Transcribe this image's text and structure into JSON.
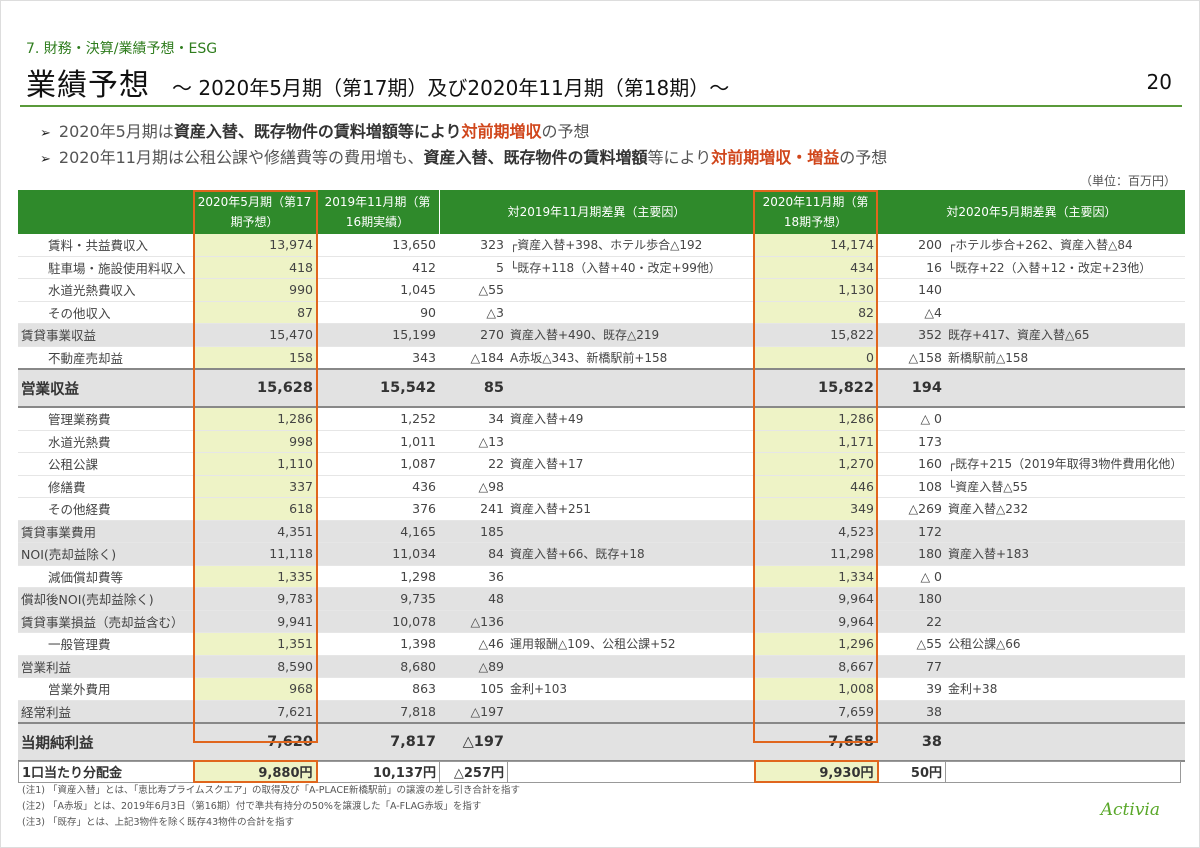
{
  "section": "7. 財務・決算/業績予想・ESG",
  "title": "業績予想",
  "subtitle": "～ 2020年5月期（第17期）及び2020年11月期（第18期）～",
  "page_number": "20",
  "bullets": [
    {
      "arrow": "➢",
      "p1": "2020年5月期は",
      "b1": "資産入替、既存物件の賃料増額等により",
      "r1": "対前期増収",
      "p2": "の予想"
    },
    {
      "arrow": "➢",
      "p1": "2020年11月期は公租公課や修繕費等の費用増も、",
      "b1": "資産入替、既存物件の賃料増額",
      "p2": "等により",
      "r1": "対前期増収・増益",
      "p3": "の予想"
    }
  ],
  "unit": "（単位：百万円）",
  "headers": {
    "col1": "2020年5月期（第17期予想）",
    "col2": "2019年11月期（第16期実績）",
    "diff1": "対2019年11月期差異（主要因）",
    "col4": "2020年11月期（第18期予想）",
    "diff2": "対2020年5月期差異（主要因）"
  },
  "rows": [
    {
      "label": "賃料・共益費収入",
      "indent": true,
      "type": "r",
      "a": "13,974",
      "b": "13,650",
      "c": "323",
      "d": "┌資産入替+398、ホテル歩合△192",
      "e": "14,174",
      "f": "200",
      "g": "┌ホテル歩合+262、資産入替△84"
    },
    {
      "label": "駐車場・施設使用料収入",
      "indent": true,
      "type": "r",
      "a": "418",
      "b": "412",
      "c": "5",
      "d": "└既存+118（入替+40・改定+99他）",
      "e": "434",
      "f": "16",
      "g": "└既存+22（入替+12・改定+23他）"
    },
    {
      "label": "水道光熱費収入",
      "indent": true,
      "type": "r",
      "a": "990",
      "b": "1,045",
      "c": "△55",
      "d": "",
      "e": "1,130",
      "f": "140",
      "g": ""
    },
    {
      "label": "その他収入",
      "indent": true,
      "type": "r",
      "a": "87",
      "b": "90",
      "c": "△3",
      "d": "",
      "e": "82",
      "f": "△4",
      "g": ""
    },
    {
      "label": "賃貸事業収益",
      "indent": false,
      "type": "sub",
      "a": "15,470",
      "b": "15,199",
      "c": "270",
      "d": "資産入替+490、既存△219",
      "e": "15,822",
      "f": "352",
      "g": "既存+417、資産入替△65"
    },
    {
      "label": "不動産売却益",
      "indent": true,
      "type": "r",
      "a": "158",
      "b": "343",
      "c": "△184",
      "d": "A赤坂△343、新橋駅前+158",
      "e": "0",
      "f": "△158",
      "g": "新橋駅前△158"
    },
    {
      "label": "営業収益",
      "indent": false,
      "type": "big",
      "a": "15,628",
      "b": "15,542",
      "c": "85",
      "d": "",
      "e": "15,822",
      "f": "194",
      "g": ""
    },
    {
      "label": "管理業務費",
      "indent": true,
      "type": "r",
      "a": "1,286",
      "b": "1,252",
      "c": "34",
      "d": "資産入替+49",
      "e": "1,286",
      "f": "△ 0",
      "g": ""
    },
    {
      "label": "水道光熱費",
      "indent": true,
      "type": "r",
      "a": "998",
      "b": "1,011",
      "c": "△13",
      "d": "",
      "e": "1,171",
      "f": "173",
      "g": ""
    },
    {
      "label": "公租公課",
      "indent": true,
      "type": "r",
      "a": "1,110",
      "b": "1,087",
      "c": "22",
      "d": "資産入替+17",
      "e": "1,270",
      "f": "160",
      "g": "┌既存+215（2019年取得3物件費用化他）"
    },
    {
      "label": "修繕費",
      "indent": true,
      "type": "r",
      "a": "337",
      "b": "436",
      "c": "△98",
      "d": "",
      "e": "446",
      "f": "108",
      "g": "└資産入替△55"
    },
    {
      "label": "その他経費",
      "indent": true,
      "type": "r",
      "a": "618",
      "b": "376",
      "c": "241",
      "d": "資産入替+251",
      "e": "349",
      "f": "△269",
      "g": "資産入替△232"
    },
    {
      "label": "賃貸事業費用",
      "indent": false,
      "type": "sub",
      "a": "4,351",
      "b": "4,165",
      "c": "185",
      "d": "",
      "e": "4,523",
      "f": "172",
      "g": ""
    },
    {
      "label": "NOI(売却益除く)",
      "indent": false,
      "type": "sub",
      "a": "11,118",
      "b": "11,034",
      "c": "84",
      "d": "資産入替+66、既存+18",
      "e": "11,298",
      "f": "180",
      "g": "資産入替+183"
    },
    {
      "label": "減価償却費等",
      "indent": true,
      "type": "r",
      "a": "1,335",
      "b": "1,298",
      "c": "36",
      "d": "",
      "e": "1,334",
      "f": "△ 0",
      "g": ""
    },
    {
      "label": "償却後NOI(売却益除く)",
      "indent": false,
      "type": "sub",
      "a": "9,783",
      "b": "9,735",
      "c": "48",
      "d": "",
      "e": "9,964",
      "f": "180",
      "g": ""
    },
    {
      "label": "賃貸事業損益（売却益含む）",
      "indent": false,
      "type": "sub",
      "a": "9,941",
      "b": "10,078",
      "c": "△136",
      "d": "",
      "e": "9,964",
      "f": "22",
      "g": ""
    },
    {
      "label": "一般管理費",
      "indent": true,
      "type": "r",
      "a": "1,351",
      "b": "1,398",
      "c": "△46",
      "d": "運用報酬△109、公租公課+52",
      "e": "1,296",
      "f": "△55",
      "g": "公租公課△66"
    },
    {
      "label": "営業利益",
      "indent": false,
      "type": "sub",
      "a": "8,590",
      "b": "8,680",
      "c": "△89",
      "d": "",
      "e": "8,667",
      "f": "77",
      "g": ""
    },
    {
      "label": "営業外費用",
      "indent": true,
      "type": "r",
      "a": "968",
      "b": "863",
      "c": "105",
      "d": "金利+103",
      "e": "1,008",
      "f": "39",
      "g": "金利+38"
    },
    {
      "label": "経常利益",
      "indent": false,
      "type": "sub",
      "a": "7,621",
      "b": "7,818",
      "c": "△197",
      "d": "",
      "e": "7,659",
      "f": "38",
      "g": ""
    },
    {
      "label": "当期純利益",
      "indent": false,
      "type": "big",
      "a": "7,620",
      "b": "7,817",
      "c": "△197",
      "d": "",
      "e": "7,658",
      "f": "38",
      "g": ""
    }
  ],
  "distribution": {
    "label": "1口当たり分配金",
    "a": "9,880円",
    "b": "10,137円",
    "c": "△257円",
    "d": "",
    "e": "9,930円",
    "f": "50円",
    "g": ""
  },
  "footnotes": [
    "(注1) 「資産入替」とは、「恵比寿プライムスクエア」の取得及び「A-PLACE新橋駅前」の譲渡の差し引き合計を指す",
    "(注2) 「A赤坂」とは、2019年6月3日（第16期）付で準共有持分の50%を譲渡した「A-FLAG赤坂」を指す",
    "(注3) 「既存」とは、上記3物件を除く既存43物件の合計を指す"
  ],
  "logo": "Activia",
  "colors": {
    "header_green": "#2f8a2b",
    "highlight": "#eef3c6",
    "accent_orange": "#e0661d",
    "accent_red": "#d0461b"
  }
}
